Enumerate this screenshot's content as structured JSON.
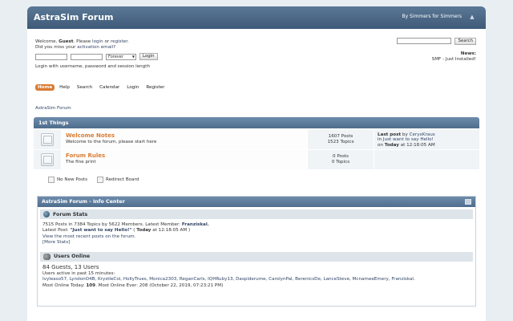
{
  "header": {
    "forum_title": "AstraSim Forum",
    "byline": "By Simmers for Simmers",
    "collapse_icon": "collapse-icon"
  },
  "user_section": {
    "welcome_prefix": "Welcome, ",
    "guest": "Guest",
    "please": ". Please ",
    "login": "login",
    "or": " or ",
    "register": "register",
    "dot": ".",
    "missed_prefix": "Did you miss your ",
    "activation_email": "activation email",
    "missed_suffix": "?",
    "login_duration_option": "Forever",
    "login_button": "Login",
    "login_hint": "Login with username, password and session length"
  },
  "search": {
    "button": "Search",
    "placeholder": ""
  },
  "news": {
    "label": "News:",
    "text": "SMF - Just Installed!"
  },
  "menu": {
    "items": [
      {
        "label": "Home"
      },
      {
        "label": "Help"
      },
      {
        "label": "Search"
      },
      {
        "label": "Calendar"
      },
      {
        "label": "Login"
      },
      {
        "label": "Register"
      }
    ]
  },
  "breadcrumb": "AstraSim Forum",
  "category": {
    "title": "1st Things",
    "boards": [
      {
        "name": "Welcome Notes",
        "description": "Welcome to the forum, please start here",
        "posts": "1607 Posts",
        "topics": "1523 Topics",
        "last_post_label": "Last post",
        "last_post_by": " by ",
        "last_post_author": "CeryxKraus",
        "in": "in ",
        "last_post_topic": "Just want to say Hello!",
        "on": "on ",
        "today": "Today",
        "time": " at 12:18:05 AM"
      },
      {
        "name": "Forum Rules",
        "description": "The fine print",
        "posts": "0 Posts",
        "topics": "0 Topics"
      }
    ]
  },
  "legend": {
    "no_new_posts": "No New Posts",
    "redirect_board": "Redirect Board"
  },
  "info_center": {
    "title": "AstraSim Forum - Info Center",
    "stats_title": "Forum Stats",
    "stats_line1_pre": "7515 Posts in 7384 Topics by 5622 Members. Latest Member: ",
    "latest_member": "Franziskal.",
    "latest_post_pre": "Latest Post: ",
    "latest_post": "\"Just want to say Hello!\"",
    "latest_post_open": " ( ",
    "latest_post_today": "Today",
    "latest_post_time": " at 12:18:05 AM )",
    "recent_link": "View the most recent posts on the forum.",
    "more_stats": "[More Stats]",
    "users_title": "Users Online",
    "users_count": "84 Guests, 13 Users",
    "users_active_label": "Users active in past 15 minutes:",
    "users_list": "Ivyleaso57, LyndonO4B, KrystleCol, HollyTrues, Monica2303, ReganCarls, IQHRuby13, Daspiderume, CarolynPal, BerenicsDe, LanceSteve, McnameeEmery, Franziskal.",
    "most_online_pre": "Most Online Today: ",
    "most_online_today": "109",
    "most_online_ever": ". Most Online Ever: 208 (October 22, 2019, 07:23:21 PM)"
  }
}
